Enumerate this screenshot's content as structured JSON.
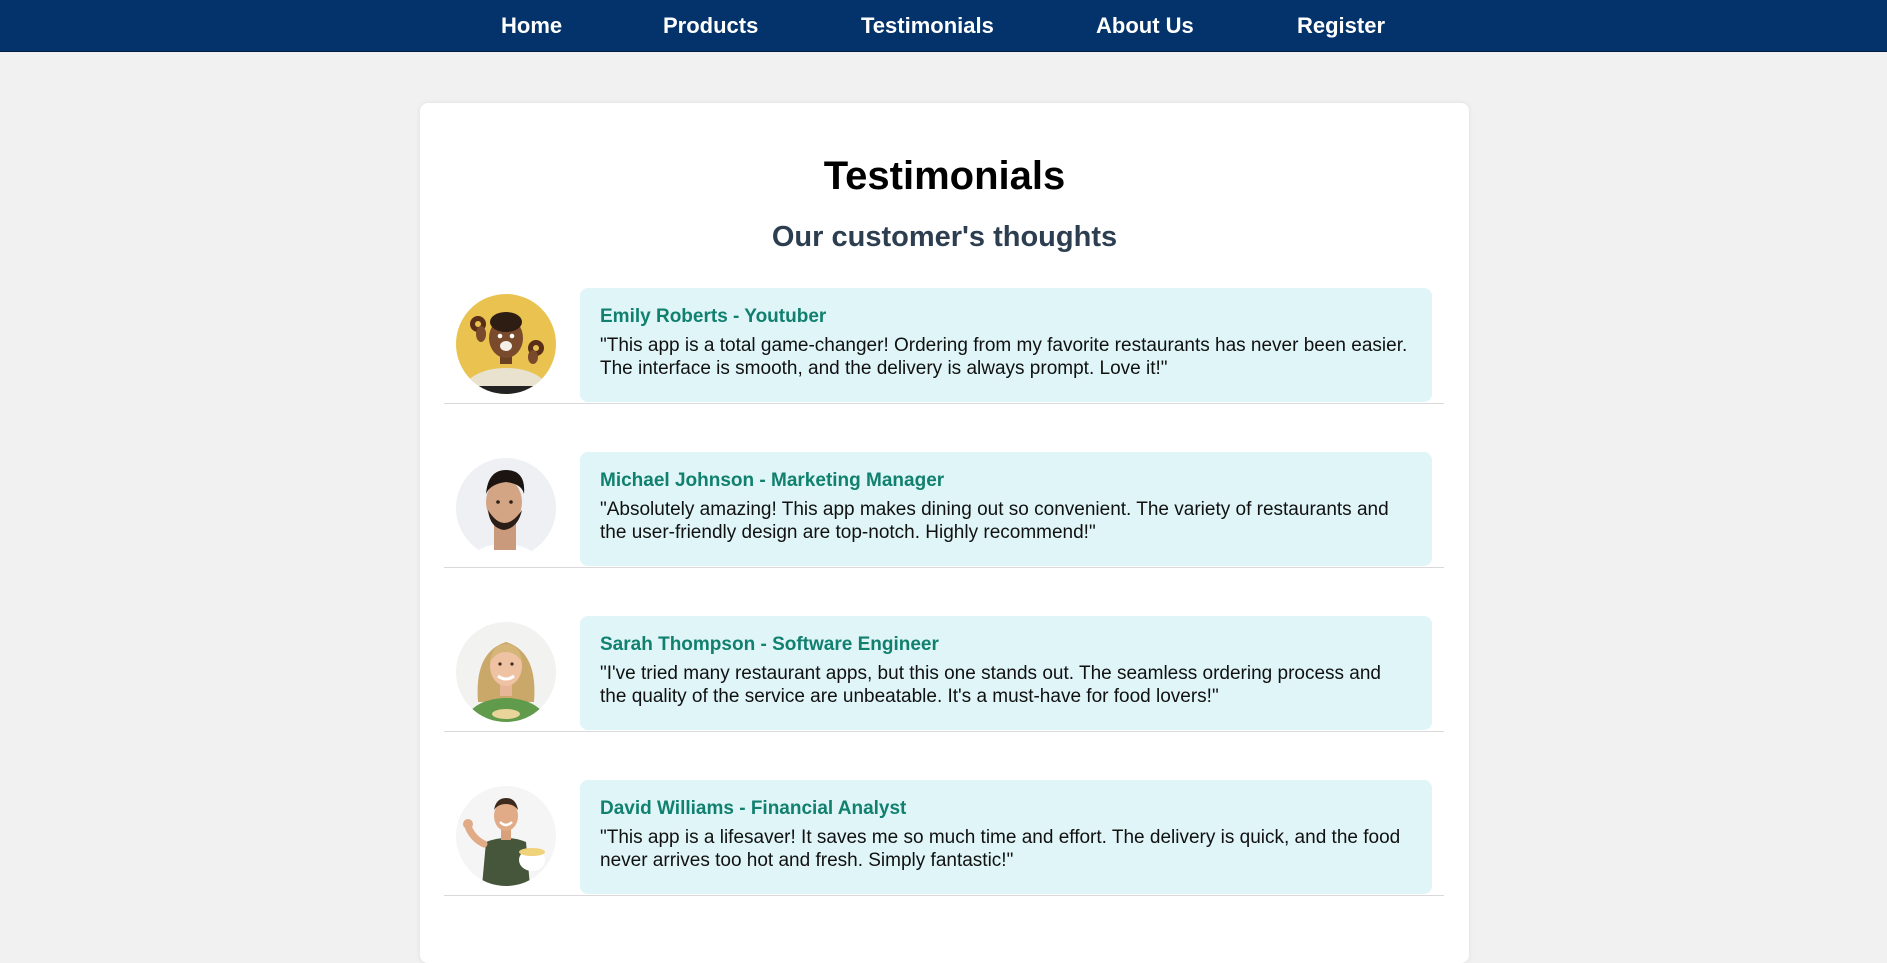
{
  "nav": {
    "home": "Home",
    "products": "Products",
    "testimonials": "Testimonials",
    "about": "About Us",
    "register": "Register"
  },
  "page": {
    "title": "Testimonials",
    "subtitle": "Our customer's thoughts"
  },
  "testimonials": [
    {
      "name": "Emily Roberts - Youtuber",
      "quote": "\"This app is a total game-changer! Ordering from my favorite restaurants has never been easier. The interface is smooth, and the delivery is always prompt. Love it!\""
    },
    {
      "name": "Michael Johnson - Marketing Manager",
      "quote": "\"Absolutely amazing! This app makes dining out so convenient. The variety of restaurants and the user-friendly design are top-notch. Highly recommend!\""
    },
    {
      "name": "Sarah Thompson - Software Engineer",
      "quote": "\"I've tried many restaurant apps, but this one stands out. The seamless ordering process and the quality of the service are unbeatable. It's a must-have for food lovers!\""
    },
    {
      "name": "David Williams - Financial Analyst",
      "quote": "\"This app is a lifesaver! It saves me so much time and effort. The delivery is quick, and the food never arrives too hot and fresh. Simply fantastic!\""
    }
  ],
  "colors": {
    "nav_background": "#03336a",
    "nav_text": "#ffffff",
    "page_background": "#f1f1f1",
    "card_background": "#ffffff",
    "bubble_background": "#dff5f8",
    "name_color": "#11806e",
    "subtitle_color": "#2c3e50"
  }
}
